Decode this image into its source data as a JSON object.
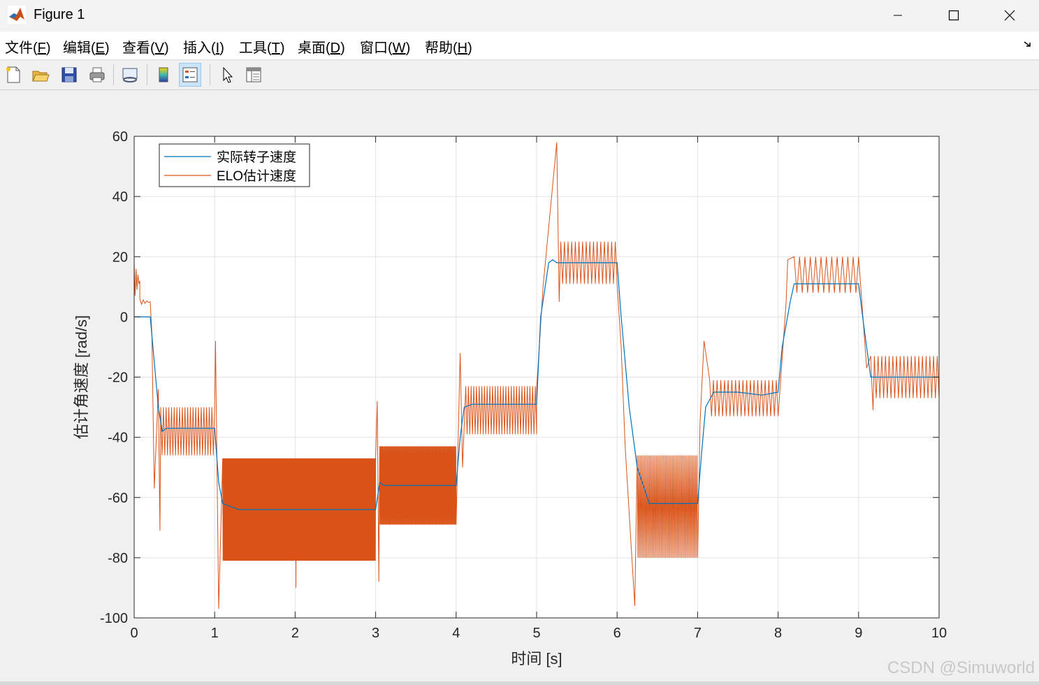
{
  "window": {
    "title": "Figure 1",
    "accent": "#0072bd"
  },
  "menu": [
    {
      "label": "文件(",
      "key": "F",
      "tail": ")"
    },
    {
      "label": "编辑(",
      "key": "E",
      "tail": ")"
    },
    {
      "label": "查看(",
      "key": "V",
      "tail": ")"
    },
    {
      "label": "插入(",
      "key": "I",
      "tail": ")"
    },
    {
      "label": "工具(",
      "key": "T",
      "tail": ")"
    },
    {
      "label": "桌面(",
      "key": "D",
      "tail": ")"
    },
    {
      "label": "窗口(",
      "key": "W",
      "tail": ")"
    },
    {
      "label": "帮助(",
      "key": "H",
      "tail": ")"
    }
  ],
  "toolbar": [
    "new-figure-icon",
    "open-file-icon",
    "save-icon",
    "print-icon",
    "link-plot-icon",
    "colorbar-icon",
    "legend-icon",
    "pointer-icon",
    "property-inspector-icon"
  ],
  "watermark": "CSDN @Simuworld",
  "chart_data": {
    "type": "line",
    "title": "",
    "xlabel": "时间 [s]",
    "ylabel": "估计角速度 [rad/s]",
    "xlim": [
      0,
      10
    ],
    "ylim": [
      -100,
      60
    ],
    "xticks": [
      0,
      1,
      2,
      3,
      4,
      5,
      6,
      7,
      8,
      9,
      10
    ],
    "yticks": [
      60,
      40,
      20,
      0,
      -20,
      -40,
      -60,
      -80,
      -100
    ],
    "grid": true,
    "legend_position": "top-left",
    "series": [
      {
        "name": "实际转子速度",
        "color": "#0072bd",
        "x": [
          0,
          0.2,
          0.3,
          0.35,
          0.4,
          1.0,
          1.05,
          1.1,
          1.3,
          3.0,
          3.05,
          3.1,
          3.3,
          4.0,
          4.05,
          4.1,
          4.2,
          5.0,
          5.05,
          5.15,
          5.2,
          5.25,
          6.0,
          6.05,
          6.15,
          6.25,
          6.4,
          7.0,
          7.05,
          7.1,
          7.2,
          7.5,
          7.8,
          8.0,
          8.05,
          8.15,
          8.2,
          9.0,
          9.05,
          9.1,
          9.15,
          10.0
        ],
        "y": [
          0,
          0,
          -30,
          -38,
          -37,
          -37,
          -55,
          -62,
          -64,
          -64,
          -55,
          -56,
          -56,
          -56,
          -40,
          -30,
          -29,
          -29,
          0,
          18,
          19,
          18,
          18,
          0,
          -30,
          -50,
          -62,
          -62,
          -45,
          -30,
          -25,
          -25,
          -26,
          -25,
          -10,
          5,
          11,
          11,
          0,
          -10,
          -20,
          -20
        ]
      },
      {
        "name": "ELO估计速度",
        "color": "#d95319",
        "bands": [
          {
            "x0": 0.0,
            "x1": 0.07,
            "center": 12,
            "amp": 6,
            "freq": 0
          },
          {
            "x0": 0.07,
            "x1": 0.2,
            "center": 5,
            "amp": 1,
            "freq": 0
          },
          {
            "x0": 0.33,
            "x1": 1.0,
            "center": -38,
            "amp": 8,
            "freq": 30
          },
          {
            "x0": 1.1,
            "x1": 3.0,
            "center": -64,
            "amp": 17,
            "freq": 130
          },
          {
            "x0": 3.05,
            "x1": 4.0,
            "center": -56,
            "amp": 13,
            "freq": 110
          },
          {
            "x0": 4.12,
            "x1": 5.0,
            "center": -31,
            "amp": 8,
            "freq": 30
          },
          {
            "x0": 5.3,
            "x1": 6.0,
            "center": 18,
            "amp": 7,
            "freq": 22
          },
          {
            "x0": 6.25,
            "x1": 7.0,
            "center": -63,
            "amp": 17,
            "freq": 55
          },
          {
            "x0": 7.15,
            "x1": 8.0,
            "center": -27,
            "amp": 6,
            "freq": 22
          },
          {
            "x0": 8.2,
            "x1": 9.0,
            "center": 14,
            "amp": 6,
            "freq": 15
          },
          {
            "x0": 9.15,
            "x1": 10.0,
            "center": -20,
            "amp": 7,
            "freq": 22
          }
        ],
        "transients": [
          {
            "x": 0.22,
            "y": -5
          },
          {
            "x": 0.25,
            "y": -57
          },
          {
            "x": 0.3,
            "y": -24
          },
          {
            "x": 0.32,
            "y": -71
          },
          {
            "x": 1.01,
            "y": -8
          },
          {
            "x": 1.05,
            "y": -97
          },
          {
            "x": 2.0,
            "y": -61
          },
          {
            "x": 2.01,
            "y": -90
          },
          {
            "x": 3.02,
            "y": -28
          },
          {
            "x": 3.04,
            "y": -88
          },
          {
            "x": 4.05,
            "y": -12
          },
          {
            "x": 4.08,
            "y": -50
          },
          {
            "x": 5.0,
            "y": -24
          },
          {
            "x": 5.08,
            "y": 10
          },
          {
            "x": 5.25,
            "y": 58
          },
          {
            "x": 5.28,
            "y": 5
          },
          {
            "x": 6.05,
            "y": -10
          },
          {
            "x": 6.1,
            "y": -43
          },
          {
            "x": 6.22,
            "y": -96
          },
          {
            "x": 7.03,
            "y": -35
          },
          {
            "x": 7.08,
            "y": -8
          },
          {
            "x": 8.1,
            "y": 5
          },
          {
            "x": 8.12,
            "y": 19
          },
          {
            "x": 9.1,
            "y": -17
          },
          {
            "x": 9.18,
            "y": -31
          }
        ]
      }
    ]
  }
}
